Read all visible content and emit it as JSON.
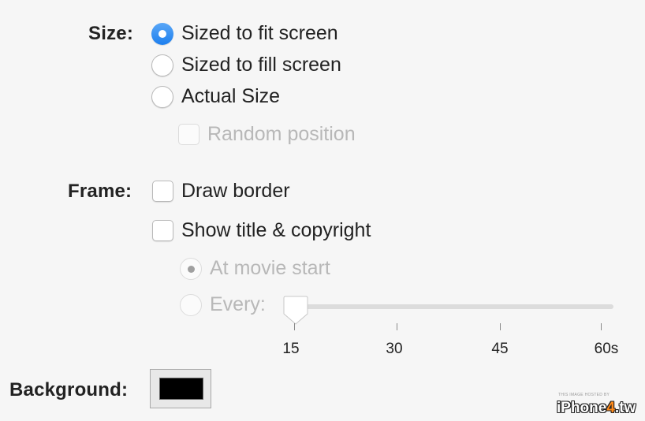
{
  "size": {
    "label": "Size:",
    "options": [
      {
        "label": "Sized to fit screen",
        "selected": true
      },
      {
        "label": "Sized to fill screen",
        "selected": false
      },
      {
        "label": "Actual Size",
        "selected": false
      }
    ],
    "random_position": {
      "label": "Random position",
      "checked": false,
      "enabled": false
    }
  },
  "frame": {
    "label": "Frame:",
    "draw_border": {
      "label": "Draw border",
      "checked": false
    },
    "show_title": {
      "label": "Show title & copyright",
      "checked": false
    },
    "title_options": [
      {
        "label": "At movie start",
        "selected": true,
        "enabled": false
      },
      {
        "label": "Every:",
        "selected": false,
        "enabled": false
      }
    ],
    "interval_slider": {
      "value": 15,
      "min": 15,
      "max": 60,
      "tick_labels": [
        "15",
        "30",
        "45",
        "60s"
      ],
      "enabled": false
    }
  },
  "background": {
    "label": "Background:",
    "color": "#000000"
  },
  "watermark": {
    "small_text": "THIS IMAGE HOSTED BY",
    "logo_prefix": "iPhone",
    "logo_number": "4",
    "logo_suffix": ".tw"
  },
  "colors": {
    "accent": "#2f8cf3",
    "disabled_text": "#b8b8b8",
    "window_bg": "#f6f6f6"
  }
}
